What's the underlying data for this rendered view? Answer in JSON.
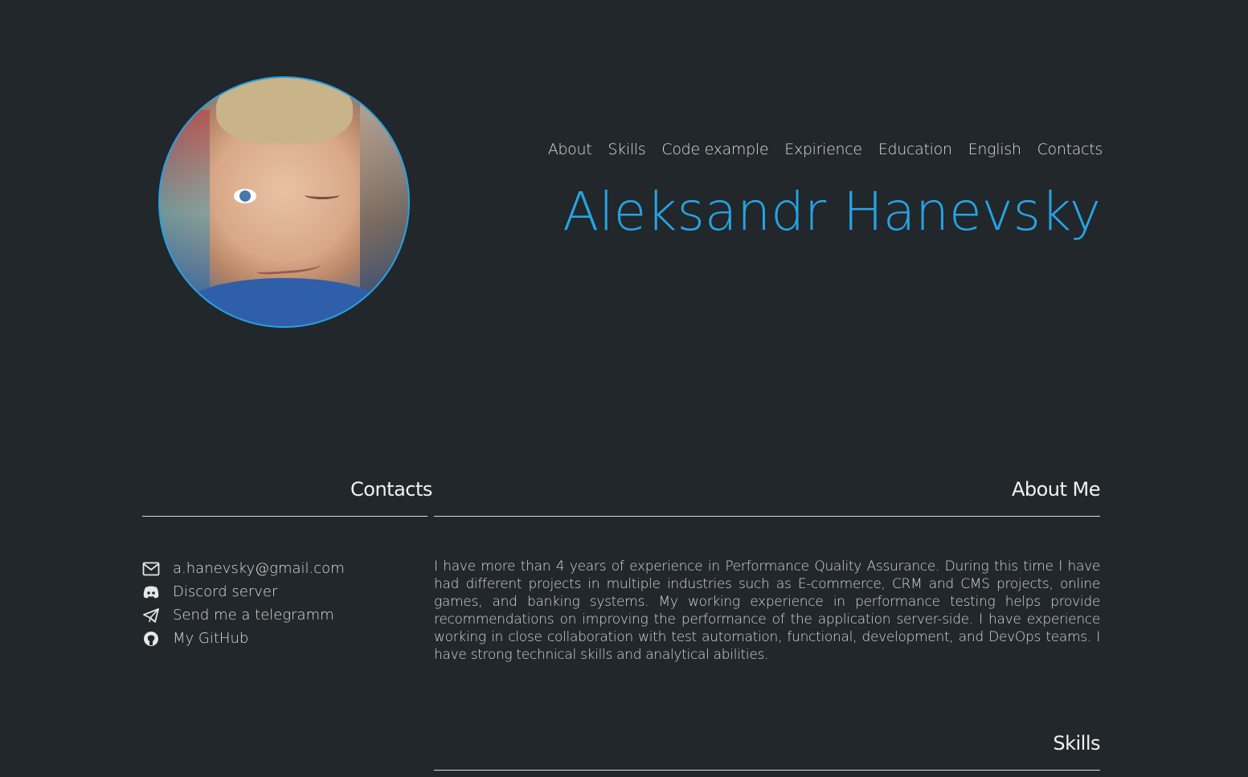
{
  "nav": {
    "items": [
      "About",
      "Skills",
      "Code example",
      "Expirience",
      "Education",
      "English",
      "Contacts"
    ]
  },
  "header": {
    "name": "Aleksandr Hanevsky"
  },
  "contacts": {
    "title": "Contacts",
    "items": [
      {
        "icon": "mail-icon",
        "label": "a.hanevsky@gmail.com"
      },
      {
        "icon": "discord-icon",
        "label": "Discord server"
      },
      {
        "icon": "telegram-icon",
        "label": "Send me a telegramm"
      },
      {
        "icon": "github-icon",
        "label": "My GitHub"
      }
    ]
  },
  "about": {
    "title": "About Me",
    "text": "I have more than 4 years of experience in Performance Quality Assurance. During this time I have had different projects in multiple industries such as E-commerce, CRM and CMS projects, online games, and banking systems. My working experience in performance testing helps provide recommendations on improving the performance of the application server-side. I have experience working in close collaboration with test automation, functional, development, and DevOps teams. I have strong technical skills and analytical abilities."
  },
  "skills": {
    "title": "Skills"
  },
  "colors": {
    "background": "#22272b",
    "accent": "#25a4e2",
    "text": "#dcdcdc"
  }
}
